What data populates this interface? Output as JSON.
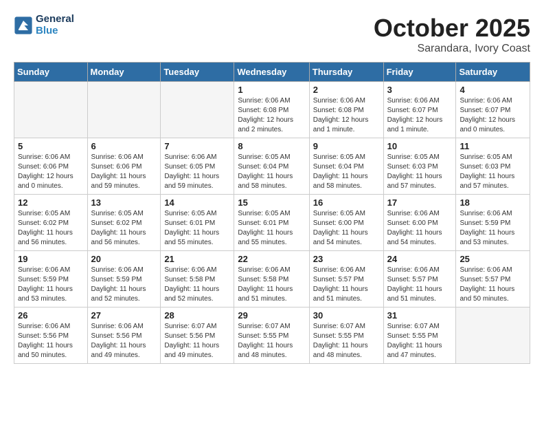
{
  "header": {
    "logo_line1": "General",
    "logo_line2": "Blue",
    "month": "October 2025",
    "location": "Sarandara, Ivory Coast"
  },
  "weekdays": [
    "Sunday",
    "Monday",
    "Tuesday",
    "Wednesday",
    "Thursday",
    "Friday",
    "Saturday"
  ],
  "weeks": [
    [
      {
        "day": "",
        "info": ""
      },
      {
        "day": "",
        "info": ""
      },
      {
        "day": "",
        "info": ""
      },
      {
        "day": "1",
        "info": "Sunrise: 6:06 AM\nSunset: 6:08 PM\nDaylight: 12 hours\nand 2 minutes."
      },
      {
        "day": "2",
        "info": "Sunrise: 6:06 AM\nSunset: 6:08 PM\nDaylight: 12 hours\nand 1 minute."
      },
      {
        "day": "3",
        "info": "Sunrise: 6:06 AM\nSunset: 6:07 PM\nDaylight: 12 hours\nand 1 minute."
      },
      {
        "day": "4",
        "info": "Sunrise: 6:06 AM\nSunset: 6:07 PM\nDaylight: 12 hours\nand 0 minutes."
      }
    ],
    [
      {
        "day": "5",
        "info": "Sunrise: 6:06 AM\nSunset: 6:06 PM\nDaylight: 12 hours\nand 0 minutes."
      },
      {
        "day": "6",
        "info": "Sunrise: 6:06 AM\nSunset: 6:06 PM\nDaylight: 11 hours\nand 59 minutes."
      },
      {
        "day": "7",
        "info": "Sunrise: 6:06 AM\nSunset: 6:05 PM\nDaylight: 11 hours\nand 59 minutes."
      },
      {
        "day": "8",
        "info": "Sunrise: 6:05 AM\nSunset: 6:04 PM\nDaylight: 11 hours\nand 58 minutes."
      },
      {
        "day": "9",
        "info": "Sunrise: 6:05 AM\nSunset: 6:04 PM\nDaylight: 11 hours\nand 58 minutes."
      },
      {
        "day": "10",
        "info": "Sunrise: 6:05 AM\nSunset: 6:03 PM\nDaylight: 11 hours\nand 57 minutes."
      },
      {
        "day": "11",
        "info": "Sunrise: 6:05 AM\nSunset: 6:03 PM\nDaylight: 11 hours\nand 57 minutes."
      }
    ],
    [
      {
        "day": "12",
        "info": "Sunrise: 6:05 AM\nSunset: 6:02 PM\nDaylight: 11 hours\nand 56 minutes."
      },
      {
        "day": "13",
        "info": "Sunrise: 6:05 AM\nSunset: 6:02 PM\nDaylight: 11 hours\nand 56 minutes."
      },
      {
        "day": "14",
        "info": "Sunrise: 6:05 AM\nSunset: 6:01 PM\nDaylight: 11 hours\nand 55 minutes."
      },
      {
        "day": "15",
        "info": "Sunrise: 6:05 AM\nSunset: 6:01 PM\nDaylight: 11 hours\nand 55 minutes."
      },
      {
        "day": "16",
        "info": "Sunrise: 6:05 AM\nSunset: 6:00 PM\nDaylight: 11 hours\nand 54 minutes."
      },
      {
        "day": "17",
        "info": "Sunrise: 6:06 AM\nSunset: 6:00 PM\nDaylight: 11 hours\nand 54 minutes."
      },
      {
        "day": "18",
        "info": "Sunrise: 6:06 AM\nSunset: 5:59 PM\nDaylight: 11 hours\nand 53 minutes."
      }
    ],
    [
      {
        "day": "19",
        "info": "Sunrise: 6:06 AM\nSunset: 5:59 PM\nDaylight: 11 hours\nand 53 minutes."
      },
      {
        "day": "20",
        "info": "Sunrise: 6:06 AM\nSunset: 5:59 PM\nDaylight: 11 hours\nand 52 minutes."
      },
      {
        "day": "21",
        "info": "Sunrise: 6:06 AM\nSunset: 5:58 PM\nDaylight: 11 hours\nand 52 minutes."
      },
      {
        "day": "22",
        "info": "Sunrise: 6:06 AM\nSunset: 5:58 PM\nDaylight: 11 hours\nand 51 minutes."
      },
      {
        "day": "23",
        "info": "Sunrise: 6:06 AM\nSunset: 5:57 PM\nDaylight: 11 hours\nand 51 minutes."
      },
      {
        "day": "24",
        "info": "Sunrise: 6:06 AM\nSunset: 5:57 PM\nDaylight: 11 hours\nand 51 minutes."
      },
      {
        "day": "25",
        "info": "Sunrise: 6:06 AM\nSunset: 5:57 PM\nDaylight: 11 hours\nand 50 minutes."
      }
    ],
    [
      {
        "day": "26",
        "info": "Sunrise: 6:06 AM\nSunset: 5:56 PM\nDaylight: 11 hours\nand 50 minutes."
      },
      {
        "day": "27",
        "info": "Sunrise: 6:06 AM\nSunset: 5:56 PM\nDaylight: 11 hours\nand 49 minutes."
      },
      {
        "day": "28",
        "info": "Sunrise: 6:07 AM\nSunset: 5:56 PM\nDaylight: 11 hours\nand 49 minutes."
      },
      {
        "day": "29",
        "info": "Sunrise: 6:07 AM\nSunset: 5:55 PM\nDaylight: 11 hours\nand 48 minutes."
      },
      {
        "day": "30",
        "info": "Sunrise: 6:07 AM\nSunset: 5:55 PM\nDaylight: 11 hours\nand 48 minutes."
      },
      {
        "day": "31",
        "info": "Sunrise: 6:07 AM\nSunset: 5:55 PM\nDaylight: 11 hours\nand 47 minutes."
      },
      {
        "day": "",
        "info": ""
      }
    ]
  ]
}
